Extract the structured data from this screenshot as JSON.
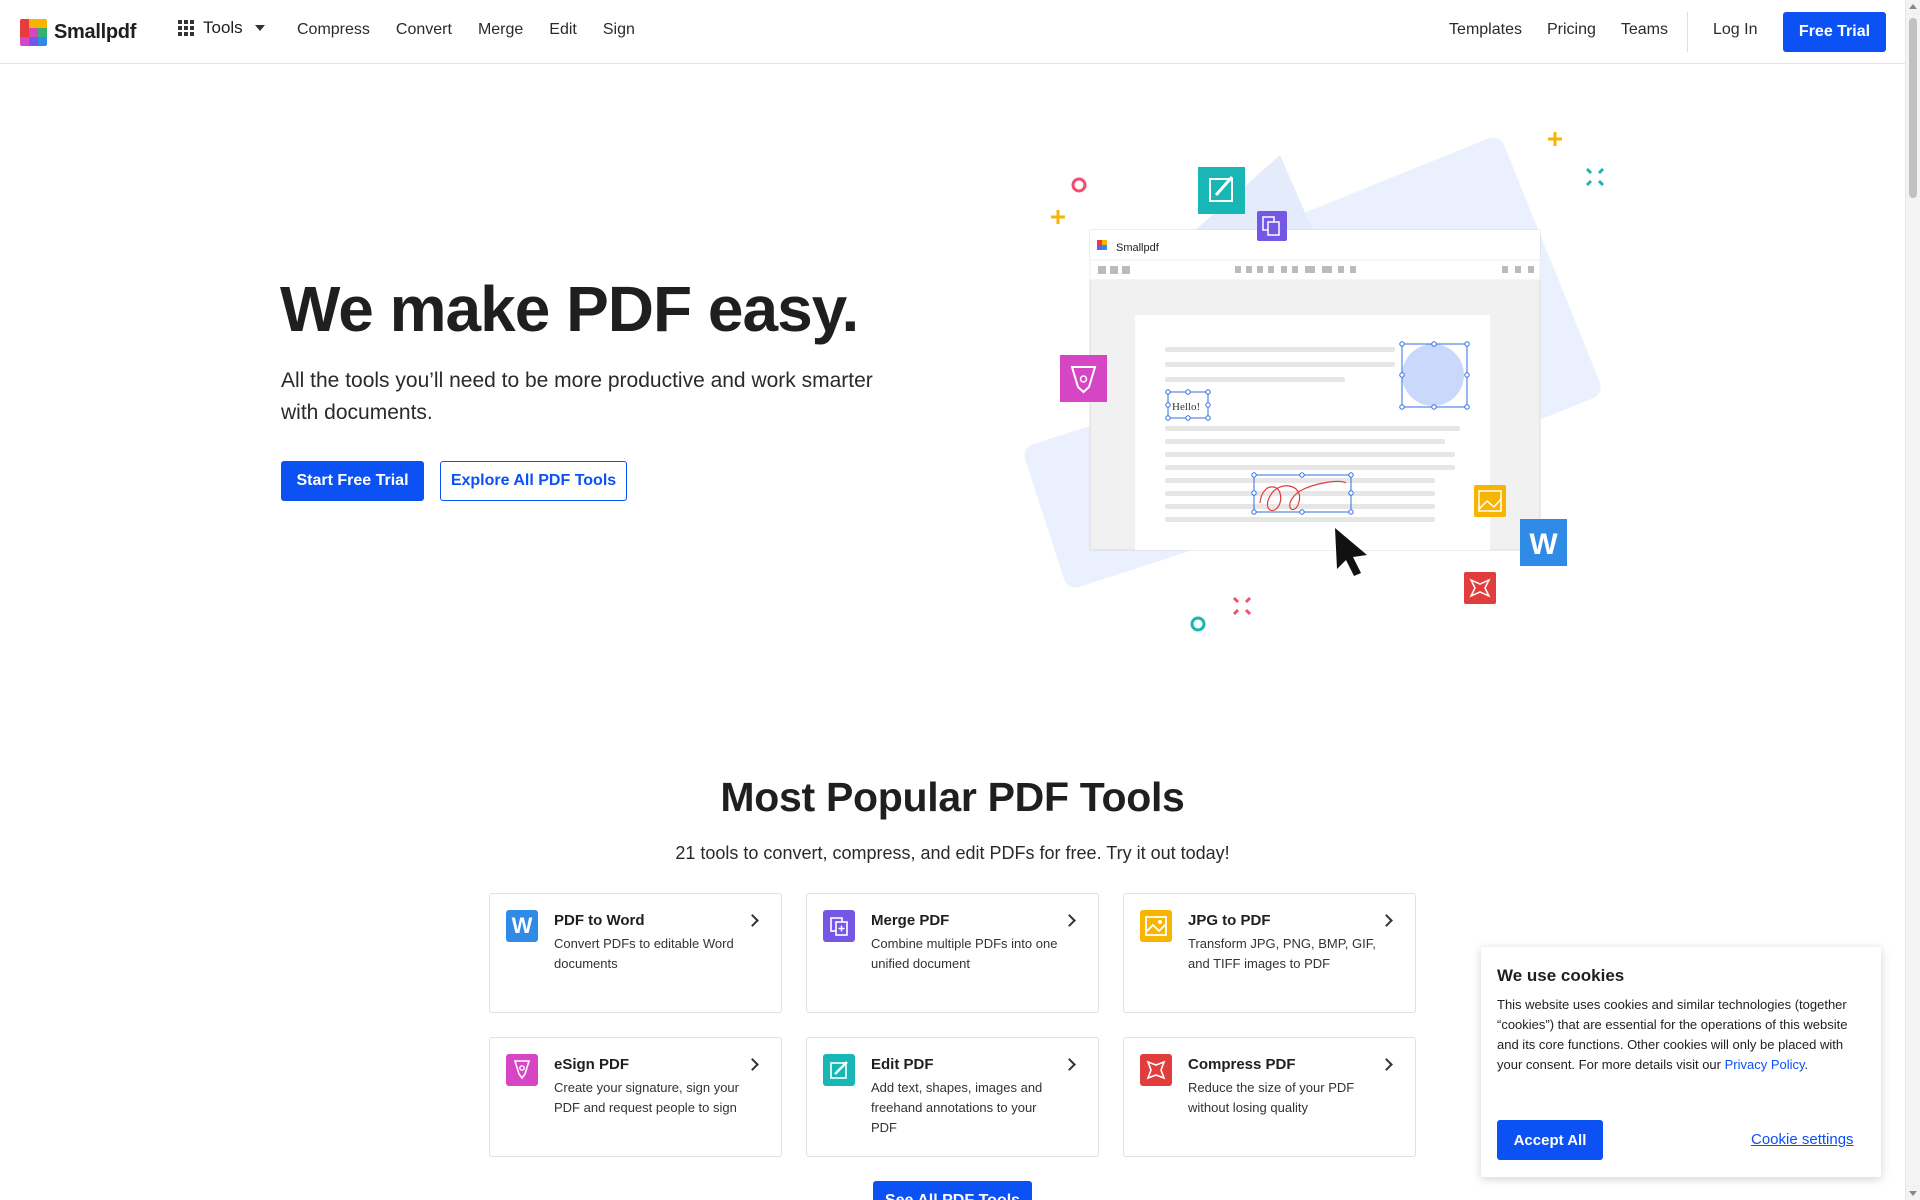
{
  "header": {
    "logo_text": "Smallpdf",
    "tools_label": "Tools",
    "nav": [
      "Compress",
      "Convert",
      "Merge",
      "Edit",
      "Sign"
    ],
    "right_nav": [
      "Templates",
      "Pricing",
      "Teams"
    ],
    "login": "Log In",
    "free_trial": "Free Trial"
  },
  "hero": {
    "title": "We make PDF easy.",
    "subtitle": "All the tools you’ll need to be more productive and work smarter with documents.",
    "primary_button": "Start Free Trial",
    "secondary_button": "Explore All PDF Tools"
  },
  "illustration": {
    "app_name": "Smallpdf",
    "sample_text": "Hello!"
  },
  "popular": {
    "title": "Most Popular PDF Tools",
    "subtitle": "21 tools to convert, compress, and edit PDFs for free. Try it out today!",
    "tools": [
      {
        "name": "PDF to Word",
        "desc": "Convert PDFs to editable Word documents",
        "color": "#2f8be6",
        "icon": "word-icon"
      },
      {
        "name": "Merge PDF",
        "desc": "Combine multiple PDFs into one unified document",
        "color": "#7557e6",
        "icon": "merge-icon"
      },
      {
        "name": "JPG to PDF",
        "desc": "Transform JPG, PNG, BMP, GIF, and TIFF images to PDF",
        "color": "#f7b400",
        "icon": "image-icon"
      },
      {
        "name": "eSign PDF",
        "desc": "Create your signature, sign your PDF and request people to sign",
        "color": "#d645c4",
        "icon": "pen-nib-icon"
      },
      {
        "name": "Edit PDF",
        "desc": "Add text, shapes, images and freehand annotations to your PDF",
        "color": "#18b6b4",
        "icon": "edit-icon"
      },
      {
        "name": "Compress PDF",
        "desc": "Reduce the size of your PDF without losing quality",
        "color": "#e23d3d",
        "icon": "compress-icon"
      }
    ],
    "see_all": "See All PDF Tools"
  },
  "cookie": {
    "title": "We use cookies",
    "text": "This website uses cookies and similar technologies (together “cookies”) that are essential for the operations of this website and its core functions. Other cookies will only be placed with your consent. For more details visit our ",
    "link": "Privacy Policy",
    "accept": "Accept All",
    "settings": "Cookie settings"
  },
  "colors": {
    "brand_blue": "#0b51f4",
    "logo": [
      "#e83c3c",
      "#f7b400",
      "#34b26c",
      "#2f8be6",
      "#7557e6",
      "#d645c4"
    ]
  }
}
